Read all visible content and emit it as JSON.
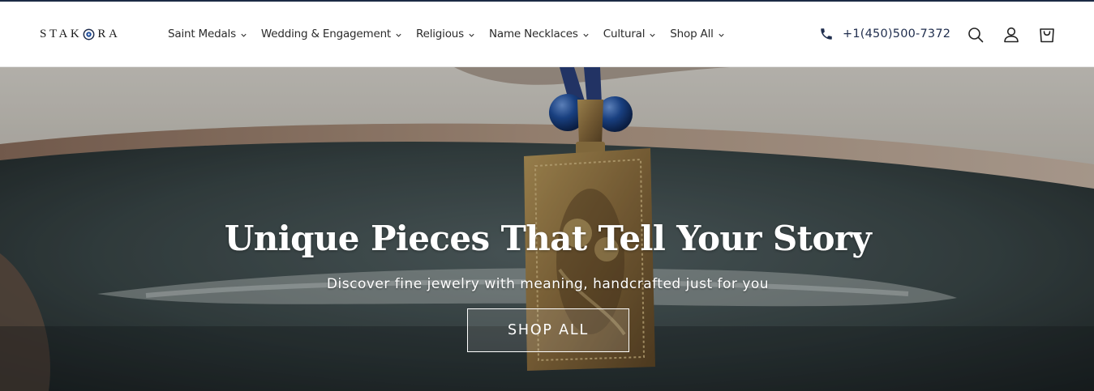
{
  "brand": {
    "logo_before": "STAK",
    "logo_after": "RA"
  },
  "nav": {
    "items": [
      {
        "label": "Saint Medals"
      },
      {
        "label": "Wedding & Engagement"
      },
      {
        "label": "Religious"
      },
      {
        "label": "Name Necklaces"
      },
      {
        "label": "Cultural"
      },
      {
        "label": "Shop All"
      }
    ]
  },
  "header": {
    "phone": "+1(450)500-7372",
    "icons": [
      "phone-icon",
      "search-icon",
      "account-icon",
      "cart-icon"
    ]
  },
  "hero": {
    "title": "Unique Pieces That Tell Your Story",
    "subtitle": "Discover fine jewelry with meaning, handcrafted just for you",
    "cta_label": "SHOP ALL"
  },
  "colors": {
    "accent_navy": "#1f2d4d",
    "top_rule": "#1b2a44",
    "pendant_gold": "#a8894d",
    "bead_blue": "#1f4e9c"
  }
}
